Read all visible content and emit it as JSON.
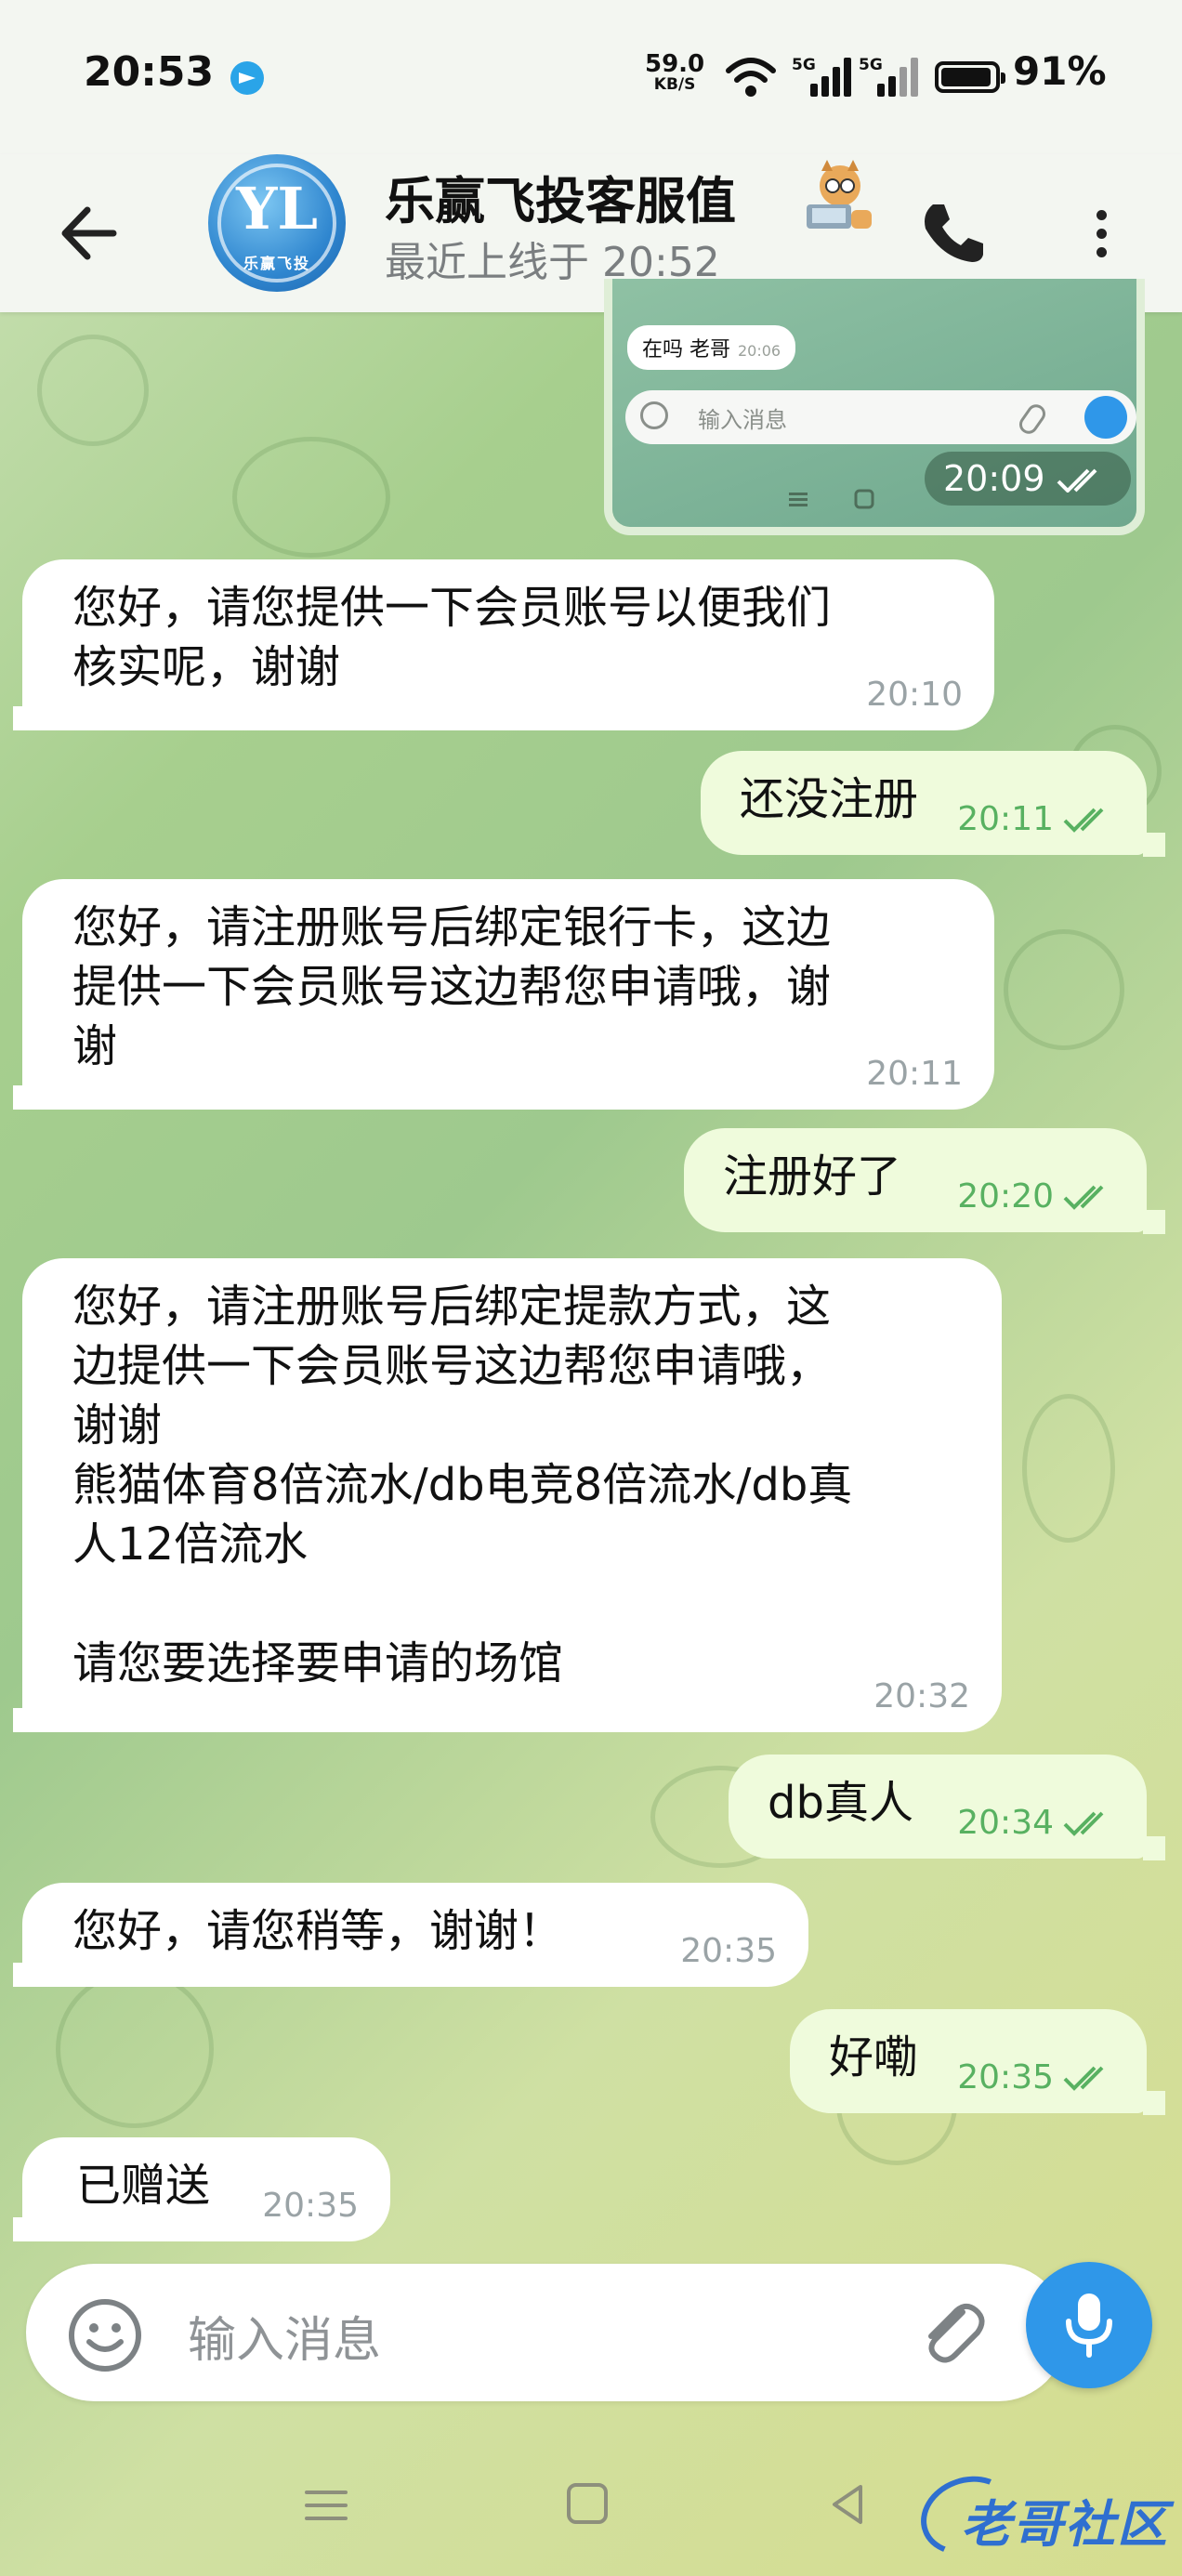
{
  "status_bar": {
    "time": "20:53",
    "net_speed": "59.0",
    "net_speed_unit": "KB/S",
    "signal_1_label": "5G",
    "signal_2_label": "5G",
    "battery": "91%"
  },
  "header": {
    "title": "乐赢飞投客服值",
    "subtitle": "最近上线于 20:52",
    "avatar_logo": "YL",
    "avatar_caption": "乐赢飞投"
  },
  "forwarded_screenshot": {
    "message_text": "在吗 老哥",
    "message_time": "20:06",
    "input_placeholder": "输入消息",
    "time": "20:09"
  },
  "messages": [
    {
      "side": "in",
      "text": "您好，请您提供一下会员账号以便我们\n核实呢，谢谢",
      "time": "20:10"
    },
    {
      "side": "out",
      "text": "还没注册",
      "time": "20:11"
    },
    {
      "side": "in",
      "text": "您好，请注册账号后绑定银行卡，这边\n提供一下会员账号这边帮您申请哦，谢\n谢",
      "time": "20:11"
    },
    {
      "side": "out",
      "text": "注册好了",
      "time": "20:20"
    },
    {
      "side": "in",
      "text": "您好，请注册账号后绑定提款方式，这\n边提供一下会员账号这边帮您申请哦，\n谢谢\n熊猫体育8倍流水/db电竞8倍流水/db真\n人12倍流水\n\n请您要选择要申请的场馆",
      "time": "20:32"
    },
    {
      "side": "out",
      "text": "db真人",
      "time": "20:34"
    },
    {
      "side": "in",
      "text": "您好，请您稍等，谢谢！",
      "time": "20:35"
    },
    {
      "side": "out",
      "text": "好嘞",
      "time": "20:35"
    },
    {
      "side": "in",
      "text": "已赠送",
      "time": "20:35"
    }
  ],
  "composer": {
    "placeholder": "输入消息"
  },
  "watermark": {
    "text": "老哥社区"
  },
  "colors": {
    "incoming_bubble": "#ffffff",
    "outgoing_bubble": "#effbdc",
    "outgoing_time": "#58b161",
    "accent_blue": "#2f97e9"
  }
}
